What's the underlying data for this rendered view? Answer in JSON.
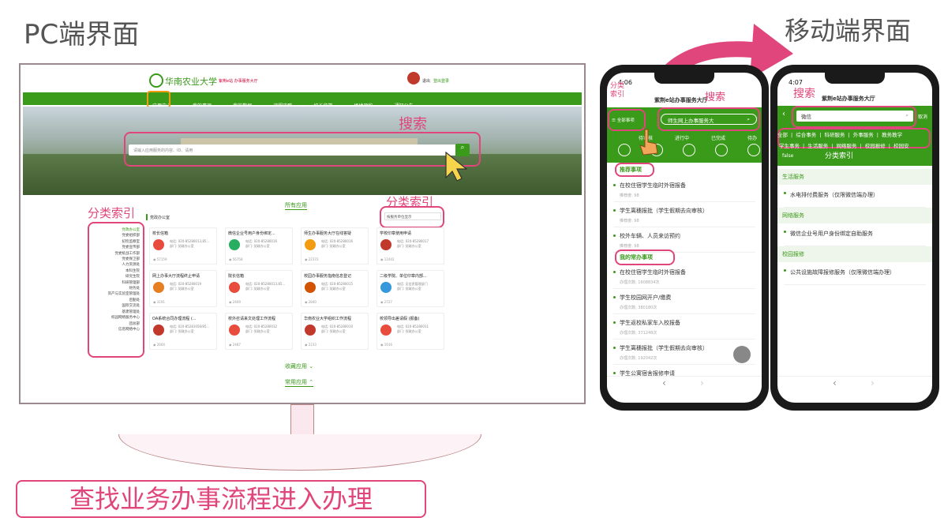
{
  "pc_title": "PC端界面",
  "mobile_title": "移动端界面",
  "caption": "查找业务办事流程进入办理",
  "pc": {
    "logo": "华南农业大学",
    "logo_sub": "紫荆e站 办事服务大厅",
    "user_label": "退出",
    "user_name": "登出登录",
    "nav": [
      "应用中心",
      "我的事项",
      "我的数据",
      "流程攻略",
      "校长信箱",
      "场地预约",
      "通知公告"
    ],
    "search_label": "搜索",
    "search_placeholder": "请输入应用服务的内容、ID、请用",
    "cat_label": "分类索引",
    "cat_label2": "分类索引",
    "all_apps": "所有应用",
    "dept_title": "党政办公室",
    "dept_filter": "按服务单位显示",
    "side_categories": [
      "党政办公室",
      "党委组织部",
      "纪检监察室",
      "党委宣传部",
      "党委统战工作部",
      "党委保卫部",
      "人力资源处",
      "本科生院",
      "研究生院",
      "科研管理部",
      "财务处",
      "资产与实验室管理处",
      "后勤处",
      "国际交流处",
      "基建管理处",
      "校园网络服务中心",
      "团总部",
      "信息网络中心"
    ],
    "cards": [
      {
        "title": "校长信箱",
        "phone": "电话: 020-85280013,85...",
        "dept": "部门: 党政办公室",
        "count": "57159"
      },
      {
        "title": "微信企业号用户身份绑定...",
        "phone": "电话: 020-85280016",
        "dept": "部门: 党政办公室",
        "count": "56758"
      },
      {
        "title": "师生办事服务大厅在线答疑",
        "phone": "电话: 020-85280016",
        "dept": "部门: 党政办公室",
        "count": "22372"
      },
      {
        "title": "学校印章使用申请",
        "phone": "电话: 020-85280017",
        "dept": "部门: 党政办公室",
        "count": "12442"
      },
      {
        "title": "网上办事大厅流程终止申请",
        "phone": "电话: 020-85280019",
        "dept": "部门: 党政办公室",
        "count": "3191"
      },
      {
        "title": "院长信箱",
        "phone": "电话: 020-85280013,85...",
        "dept": "部门: 党政办公室",
        "count": "2469"
      },
      {
        "title": "校园办事服务指南信息登记",
        "phone": "电话: 020-85280015",
        "dept": "部门: 党政办公室",
        "count": "2840"
      },
      {
        "title": "二级学院、单位印章内部...",
        "phone": "电话: 见信息管理部门",
        "dept": "部门: 党政办公室",
        "count": "2727"
      },
      {
        "title": "OA系统合同办理流程 (...",
        "phone": "电话: 020-85281056/85...",
        "dept": "部门: 党政办公室",
        "count": "2664"
      },
      {
        "title": "校外召请来文处理工作流程",
        "phone": "电话: 020-85280012",
        "dept": "部门: 党政办公室",
        "count": "2487"
      },
      {
        "title": "华南农业大学组织工作流程",
        "phone": "电话: 020-85280010",
        "dept": "部门: 党政办公室",
        "count": "2233"
      },
      {
        "title": "校领导出差请假 (报备)",
        "phone": "电话: 020-85280011",
        "dept": "部门: 党政办公室",
        "count": "1916"
      }
    ],
    "fav_apps": "收藏应用",
    "common_apps": "常用应用"
  },
  "phone1": {
    "time": "4:06",
    "header": "紫荆e站办事服务大厅",
    "cat_label": "分类\n索引",
    "search_label": "搜索",
    "all_btn": "全部事项",
    "search_text": "师生网上办事服务大",
    "tabs": [
      "待审核",
      "进行中",
      "已完成",
      "待办"
    ],
    "recommend": "推荐事项",
    "rec_items": [
      {
        "t": "在校住宿学生临时外宿报备",
        "s": "推荐度: 98"
      },
      {
        "t": "学生离穗报批（学生假期去向审核）",
        "s": "推荐度: 98"
      },
      {
        "t": "校外车辆、人员来访预约",
        "s": "推荐度: 98"
      }
    ],
    "common": "我的常办事项",
    "common_items": [
      {
        "t": "在校住宿学生临时外宿报备",
        "s": "办理次数: 1608834次"
      },
      {
        "t": "学生校园网开户/缴费",
        "s": "办理次数: 380180次"
      },
      {
        "t": "学生返校私家车入校报备",
        "s": "办理次数: 371248次"
      },
      {
        "t": "学生离穗报批（学生假期去向审核）",
        "s": "办理次数: 192042次"
      },
      {
        "t": "学生公寓宿舍报修申请",
        "s": ""
      }
    ]
  },
  "phone2": {
    "time": "4:07",
    "header": "紫荆e站办事服务大厅",
    "search_label": "搜索",
    "search_text": "微信",
    "cancel": "取消",
    "cats_row1": [
      "全部",
      "综合事务",
      "科研服务",
      "外事服务",
      "教务教学"
    ],
    "cats_row2": [
      "学生事务",
      "生活服务",
      "网络服务",
      "校园报修",
      "校园安"
    ],
    "cat_label": "分类索引",
    "false_tag": "false",
    "sections": [
      {
        "name": "生活服务",
        "item": "水电排付费服务（仅限微信端办理）"
      },
      {
        "name": "网络服务",
        "item": "微信企业号用户身份绑定自助服务"
      },
      {
        "name": "校园报修",
        "item": "公共设施故障报修服务（仅限微信端办理）"
      }
    ]
  },
  "colors": {
    "accent": "#e0457b",
    "brand_green": "#3a9a1a"
  }
}
